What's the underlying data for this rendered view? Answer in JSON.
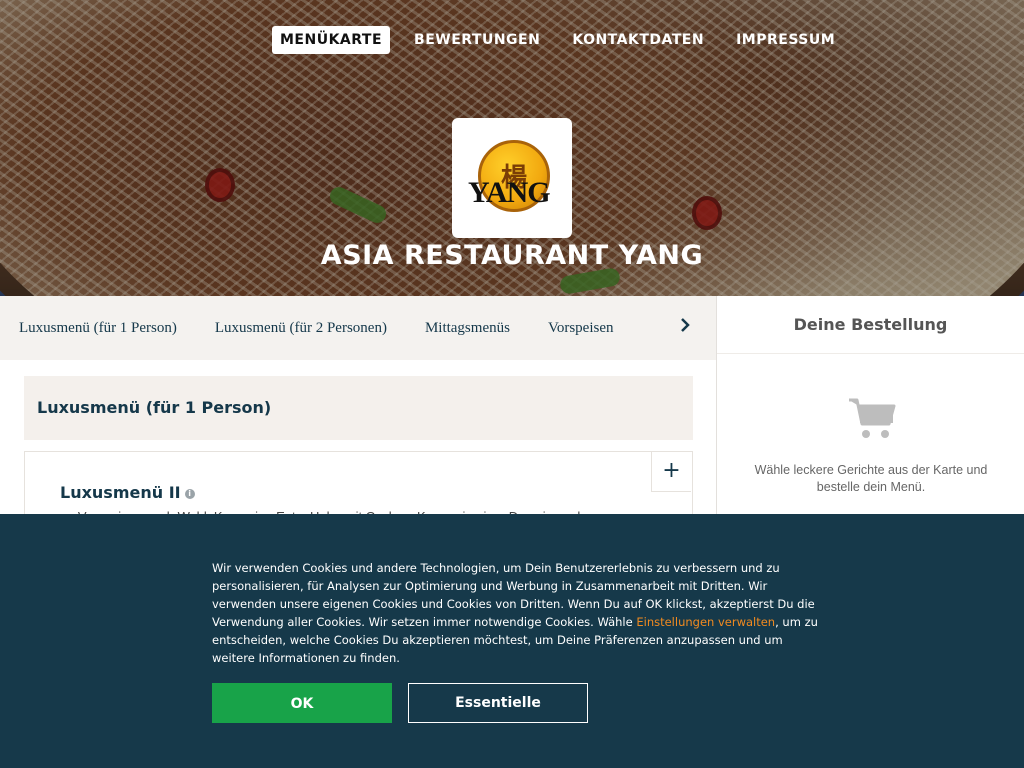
{
  "nav": {
    "items": [
      {
        "label": "MENÜKARTE",
        "active": true
      },
      {
        "label": "BEWERTUNGEN",
        "active": false
      },
      {
        "label": "KONTAKTDATEN",
        "active": false
      },
      {
        "label": "IMPRESSUM",
        "active": false
      }
    ]
  },
  "hero": {
    "logo_char": "楊",
    "logo_text": "YANG",
    "title": "ASIA RESTAURANT YANG"
  },
  "categories": {
    "items": [
      "Luxusmenü (für 1 Person)",
      "Luxusmenü (für 2 Personen)",
      "Mittagsmenüs",
      "Vorspeisen"
    ],
    "next_icon": "chevron-right-icon"
  },
  "menu": {
    "section_title": "Luxusmenü (für 1 Person)",
    "item": {
      "title": "Luxusmenü II",
      "description": "...Vorspeisen nach Wahl: Knusprige Ente, Huhn mit Cashew-Kernen in einer Dressing sehr",
      "add_label": "+"
    }
  },
  "sidebar": {
    "title": "Deine Bestellung",
    "empty_text": "Wähle leckere Gerichte aus der Karte und bestelle dein Menü.",
    "icon": "cart-icon"
  },
  "cookie": {
    "text_before": "Wir verwenden Cookies und andere Technologien, um Dein Benutzererlebnis zu verbessern und zu personalisieren, für Analysen zur Optimierung und Werbung in Zusammenarbeit mit Dritten. Wir verwenden unsere eigenen Cookies und Cookies von Dritten. Wenn Du auf OK klickst, akzeptierst Du die Verwendung aller Cookies. Wir setzen immer notwendige Cookies. Wähle ",
    "link": "Einstellungen verwalten",
    "text_after": ", um zu entscheiden, welche Cookies Du akzeptieren möchtest, um Deine Präferenzen anzupassen und um weitere Informationen zu finden.",
    "ok_label": "OK",
    "essential_label": "Essentielle",
    "colors": {
      "background": "#16394a",
      "ok": "#18a349",
      "link": "#f08a20"
    }
  }
}
